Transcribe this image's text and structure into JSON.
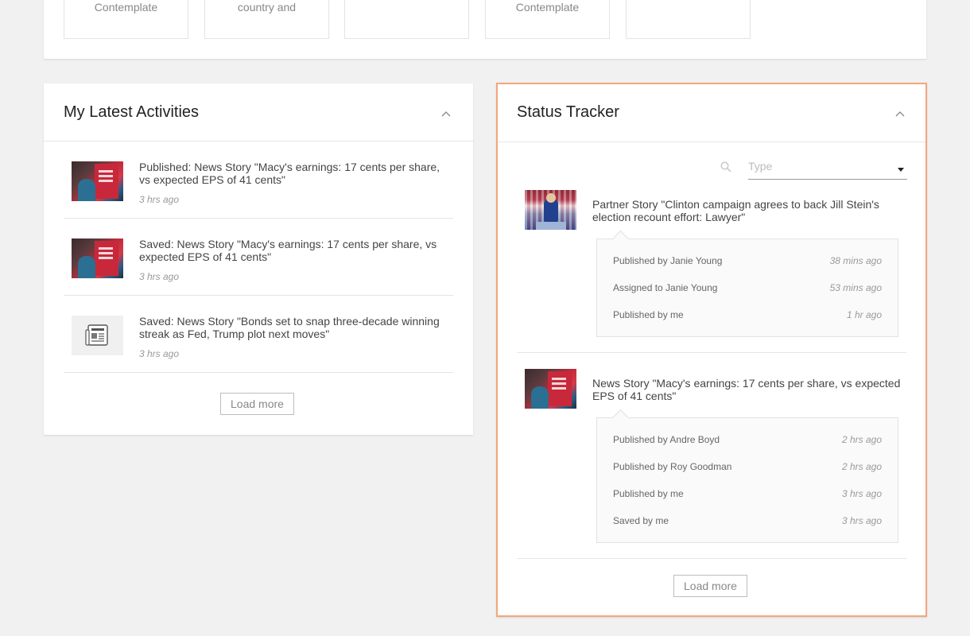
{
  "top_cards": [
    {
      "text": "Contemplate"
    },
    {
      "text": "country and"
    },
    {
      "text": ""
    },
    {
      "text": "Contemplate"
    },
    {
      "text": ""
    }
  ],
  "latest_activities": {
    "title": "My Latest Activities",
    "items": [
      {
        "text": "Published: News Story \"Macy's earnings: 17 cents per share, vs expected EPS of 41 cents\"",
        "time": "3 hrs ago",
        "thumb": "photo"
      },
      {
        "text": "Saved: News Story \"Macy's earnings: 17 cents per share, vs expected EPS of 41 cents\"",
        "time": "3 hrs ago",
        "thumb": "photo"
      },
      {
        "text": "Saved: News Story \"Bonds set to snap three-decade winning streak as Fed, Trump plot next moves\"",
        "time": "3 hrs ago",
        "thumb": "newspaper-icon"
      }
    ],
    "load_more": "Load more"
  },
  "status_tracker": {
    "title": "Status Tracker",
    "type_placeholder": "Type",
    "stories": [
      {
        "title": "Partner Story \"Clinton campaign agrees to back Jill Stein's election recount effort: Lawyer\"",
        "history": [
          {
            "who": "Published by Janie Young",
            "when": "38 mins ago"
          },
          {
            "who": "Assigned to Janie Young",
            "when": "53 mins ago"
          },
          {
            "who": "Published by me",
            "when": "1 hr ago"
          }
        ]
      },
      {
        "title": "News Story \"Macy's earnings: 17 cents per share, vs expected EPS of 41 cents\"",
        "history": [
          {
            "who": "Published by Andre Boyd",
            "when": "2 hrs ago"
          },
          {
            "who": "Published by Roy Goodman",
            "when": "2 hrs ago"
          },
          {
            "who": "Published by me",
            "when": "3 hrs ago"
          },
          {
            "who": "Saved by me",
            "when": "3 hrs ago"
          }
        ]
      }
    ],
    "load_more": "Load more"
  },
  "colors": {
    "background": "#f1f1f1",
    "highlight_border": "#f3a77d"
  }
}
